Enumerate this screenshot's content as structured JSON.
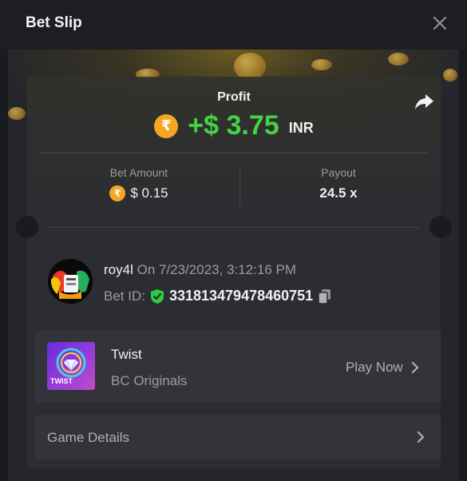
{
  "header": {
    "title": "Bet Slip"
  },
  "summary": {
    "profit_label": "Profit",
    "currency_symbol": "₹",
    "profit_value": "+$ 3.75",
    "profit_currency": "INR",
    "bet_amount_label": "Bet Amount",
    "bet_amount_value": "$ 0.15",
    "payout_label": "Payout",
    "payout_value": "24.5 x"
  },
  "bet_info": {
    "username": "roy4l",
    "date_text": "On 7/23/2023, 3:12:16 PM",
    "bet_id_label": "Bet ID:",
    "bet_id_value": "331813479478460751"
  },
  "game": {
    "name": "Twist",
    "provider": "BC Originals",
    "thumb_label": "TWIST",
    "play_label": "Play Now"
  },
  "details": {
    "label": "Game Details"
  },
  "colors": {
    "profit_green": "#43d344",
    "coin_orange": "#f5a623",
    "verified_green": "#2ecc40"
  },
  "icons": [
    "close-icon",
    "share-icon",
    "rupee-coin-icon",
    "shield-check-icon",
    "copy-icon",
    "chevron-right-icon"
  ]
}
